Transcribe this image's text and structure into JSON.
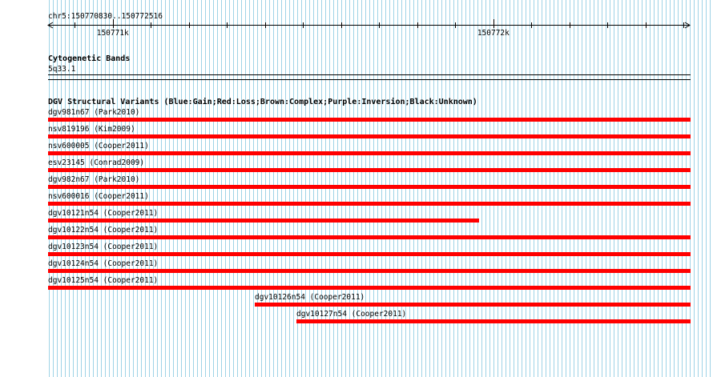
{
  "ruler": {
    "coordinates": "chr5:150770830..150772516",
    "tick_labels": [
      "150771k",
      "150772k"
    ]
  },
  "cytoband": {
    "title": "Cytogenetic Bands",
    "band": "5q33.1"
  },
  "dgv": {
    "title": "DGV Structural Variants (Blue:Gain;Red:Loss;Brown:Complex;Purple:Inversion;Black:Unknown)",
    "loss_color": "#ff0000",
    "features": [
      {
        "label": "dgv981n67 (Park2010)",
        "start": 150770830,
        "end": 150772516
      },
      {
        "label": "nsv819196 (Kim2009)",
        "start": 150770830,
        "end": 150772516
      },
      {
        "label": "nsv600005 (Cooper2011)",
        "start": 150770830,
        "end": 150772516
      },
      {
        "label": "esv23145 (Conrad2009)",
        "start": 150770830,
        "end": 150772516
      },
      {
        "label": "dgv982n67 (Park2010)",
        "start": 150770830,
        "end": 150772516
      },
      {
        "label": "nsv600016 (Cooper2011)",
        "start": 150770830,
        "end": 150772516
      },
      {
        "label": "dgv10121n54 (Cooper2011)",
        "start": 150770830,
        "end": 150771960
      },
      {
        "label": "dgv10122n54 (Cooper2011)",
        "start": 150770830,
        "end": 150772516
      },
      {
        "label": "dgv10123n54 (Cooper2011)",
        "start": 150770830,
        "end": 150772516
      },
      {
        "label": "dgv10124n54 (Cooper2011)",
        "start": 150770830,
        "end": 150772516
      },
      {
        "label": "dgv10125n54 (Cooper2011)",
        "start": 150770830,
        "end": 150772516
      },
      {
        "label": "dgv10126n54 (Cooper2011)",
        "start": 150771373,
        "end": 150772516
      },
      {
        "label": "dgv10127n54 (Cooper2011)",
        "start": 150771481,
        "end": 150772516
      }
    ]
  }
}
